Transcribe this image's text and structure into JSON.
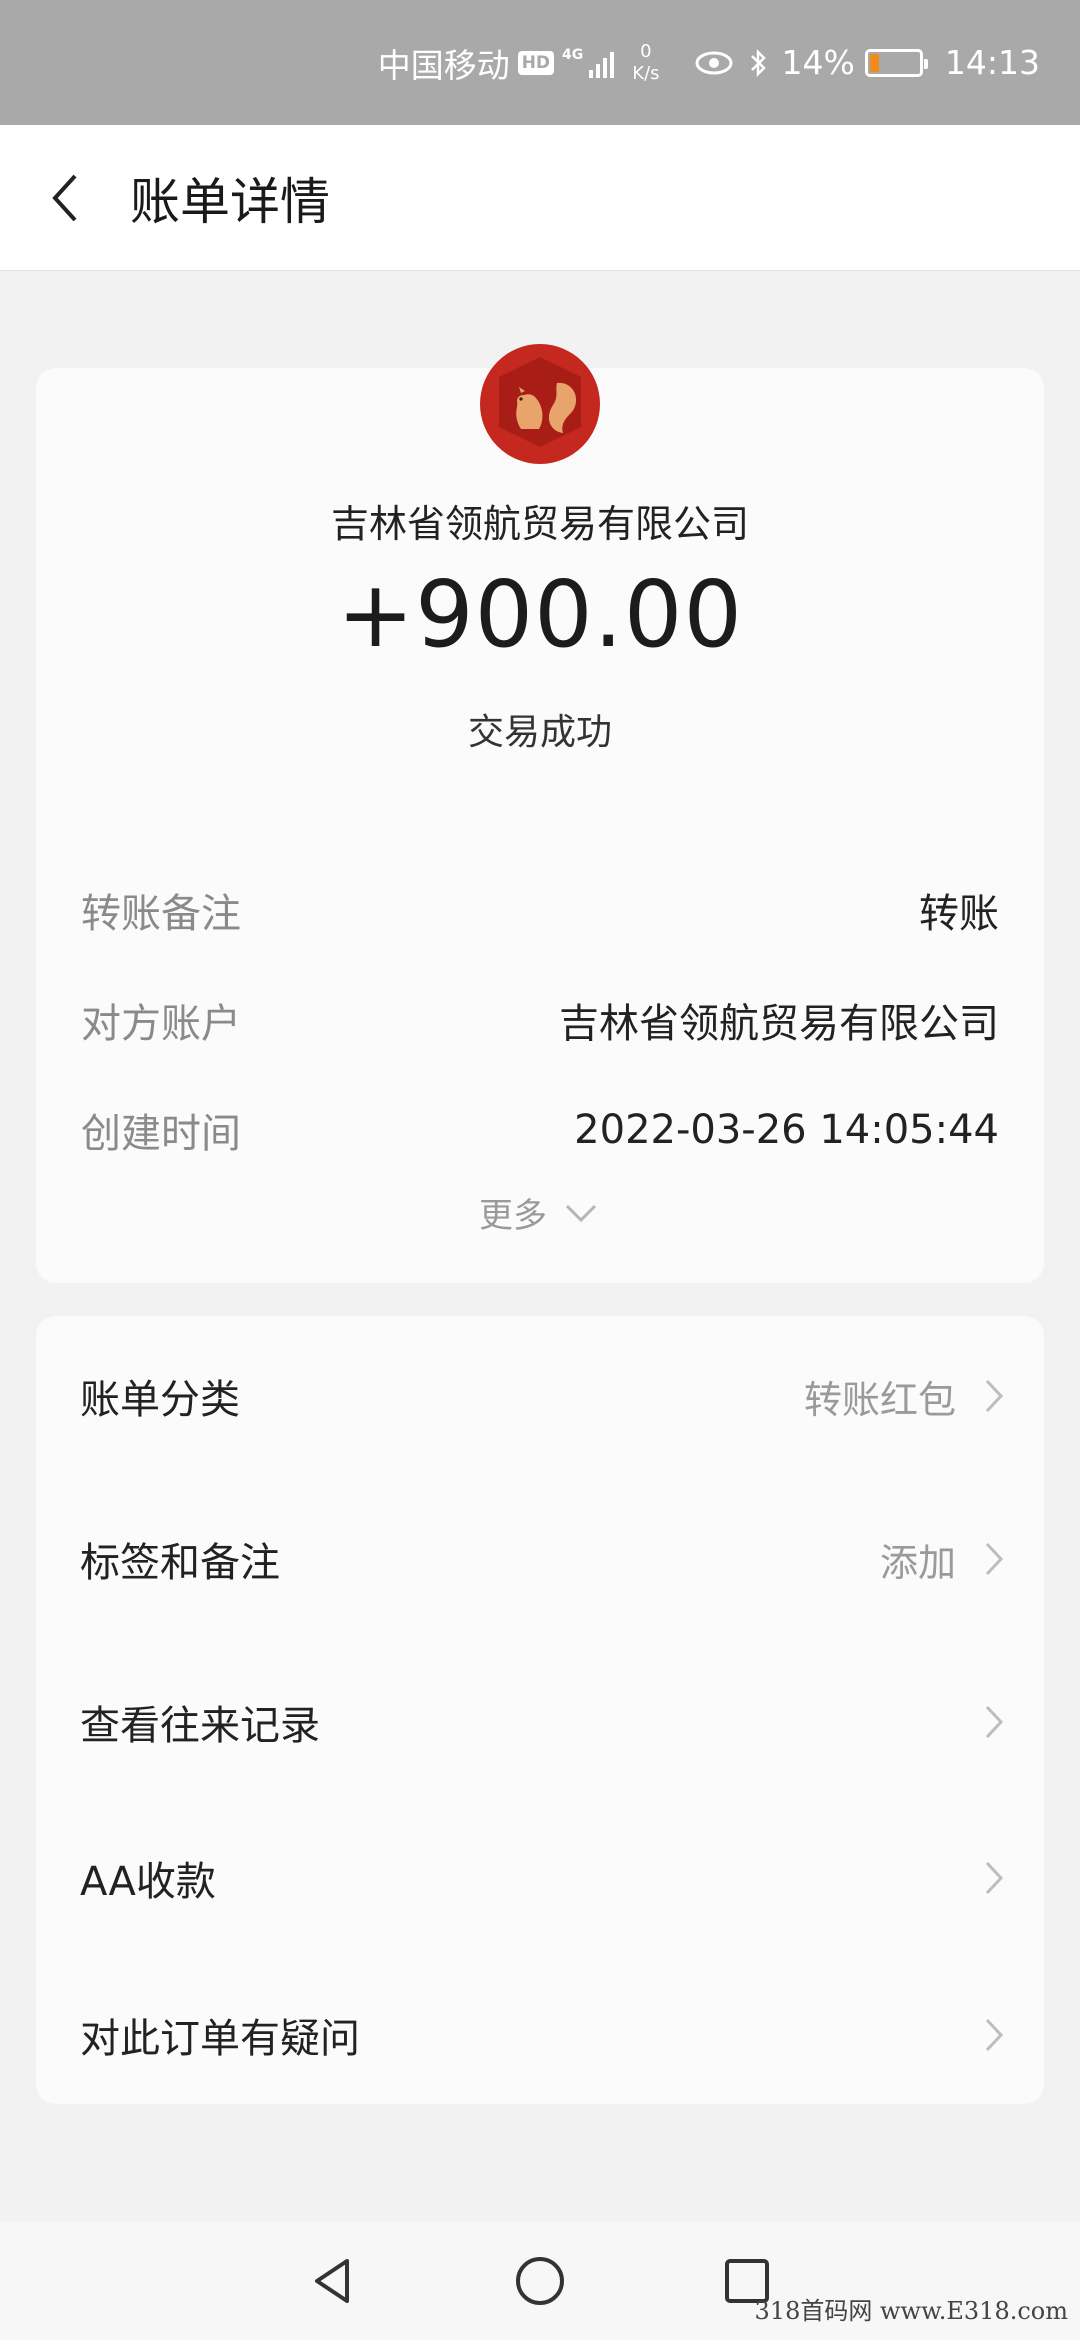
{
  "status_bar": {
    "carrier": "中国移动",
    "hd": "HD",
    "network": "4G",
    "speed_value": "0",
    "speed_unit": "K/s",
    "battery_percent": "14%",
    "battery_level": 0.14,
    "time": "14:13"
  },
  "header": {
    "title": "账单详情"
  },
  "summary": {
    "merchant_name": "吉林省领航贸易有限公司",
    "amount": "+900.00",
    "status": "交易成功",
    "details": [
      {
        "label": "转账备注",
        "value": "转账"
      },
      {
        "label": "对方账户",
        "value": "吉林省领航贸易有限公司"
      },
      {
        "label": "创建时间",
        "value": "2022-03-26 14:05:44"
      }
    ],
    "more_label": "更多"
  },
  "actions": [
    {
      "label": "账单分类",
      "value": "转账红包"
    },
    {
      "label": "标签和备注",
      "value": "添加"
    },
    {
      "label": "查看往来记录",
      "value": ""
    },
    {
      "label": "AA收款",
      "value": ""
    },
    {
      "label": "对此订单有疑问",
      "value": ""
    }
  ],
  "nav": {
    "back_icon": "triangle-back-icon",
    "home_icon": "circle-home-icon",
    "recents_icon": "square-recents-icon"
  },
  "watermark": "318首码网 www.E318.com",
  "colors": {
    "status_bar_bg": "#a9a9a9",
    "avatar_red": "#c4281f",
    "battery_orange": "#f08c1c"
  }
}
